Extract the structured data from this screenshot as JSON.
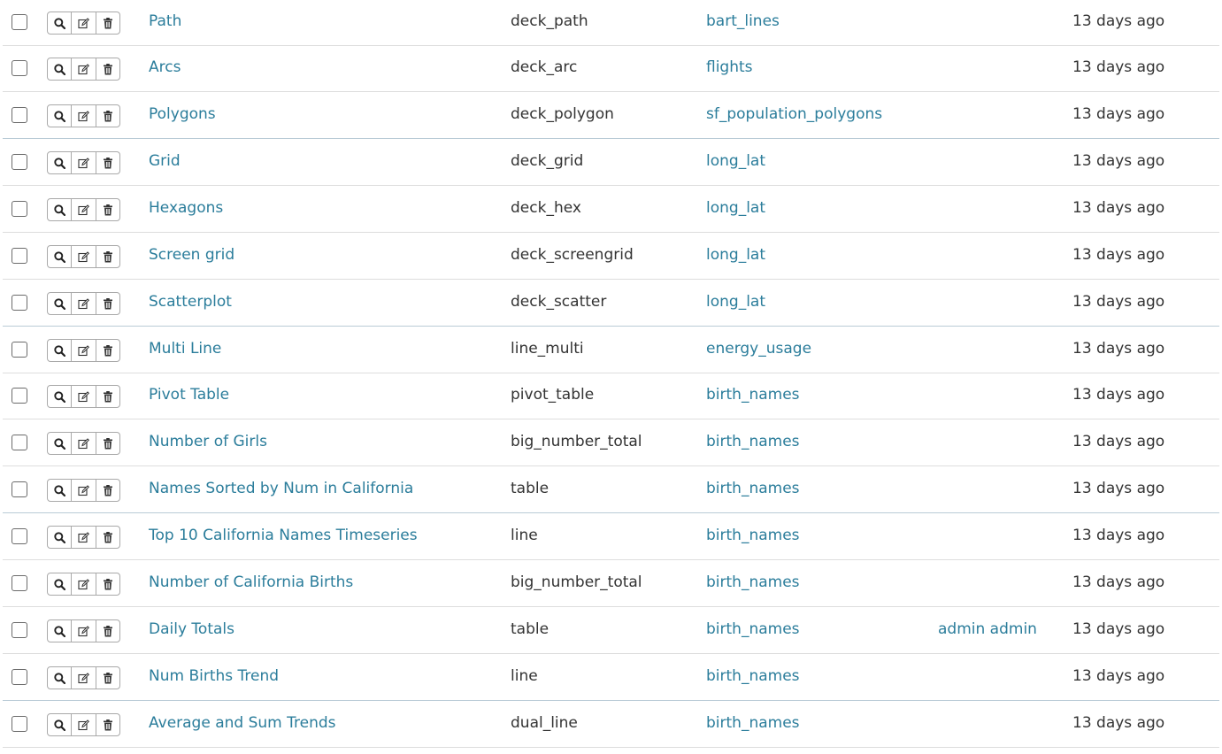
{
  "colors": {
    "link": "#2b7d9b",
    "text": "#333333",
    "border": "#dddddd"
  },
  "rows": [
    {
      "name": "Path",
      "viz_type": "deck_path",
      "datasource": "bart_lines",
      "creator": "",
      "modified": "13 days ago"
    },
    {
      "name": "Arcs",
      "viz_type": "deck_arc",
      "datasource": "flights",
      "creator": "",
      "modified": "13 days ago"
    },
    {
      "name": "Polygons",
      "viz_type": "deck_polygon",
      "datasource": "sf_population_polygons",
      "creator": "",
      "modified": "13 days ago"
    },
    {
      "name": "Grid",
      "viz_type": "deck_grid",
      "datasource": "long_lat",
      "creator": "",
      "modified": "13 days ago"
    },
    {
      "name": "Hexagons",
      "viz_type": "deck_hex",
      "datasource": "long_lat",
      "creator": "",
      "modified": "13 days ago"
    },
    {
      "name": "Screen grid",
      "viz_type": "deck_screengrid",
      "datasource": "long_lat",
      "creator": "",
      "modified": "13 days ago"
    },
    {
      "name": "Scatterplot",
      "viz_type": "deck_scatter",
      "datasource": "long_lat",
      "creator": "",
      "modified": "13 days ago"
    },
    {
      "name": "Multi Line",
      "viz_type": "line_multi",
      "datasource": "energy_usage",
      "creator": "",
      "modified": "13 days ago"
    },
    {
      "name": "Pivot Table",
      "viz_type": "pivot_table",
      "datasource": "birth_names",
      "creator": "",
      "modified": "13 days ago"
    },
    {
      "name": "Number of Girls",
      "viz_type": "big_number_total",
      "datasource": "birth_names",
      "creator": "",
      "modified": "13 days ago"
    },
    {
      "name": "Names Sorted by Num in California",
      "viz_type": "table",
      "datasource": "birth_names",
      "creator": "",
      "modified": "13 days ago"
    },
    {
      "name": "Top 10 California Names Timeseries",
      "viz_type": "line",
      "datasource": "birth_names",
      "creator": "",
      "modified": "13 days ago"
    },
    {
      "name": "Number of California Births",
      "viz_type": "big_number_total",
      "datasource": "birth_names",
      "creator": "",
      "modified": "13 days ago"
    },
    {
      "name": "Daily Totals",
      "viz_type": "table",
      "datasource": "birth_names",
      "creator": "admin admin",
      "modified": "13 days ago"
    },
    {
      "name": "Num Births Trend",
      "viz_type": "line",
      "datasource": "birth_names",
      "creator": "",
      "modified": "13 days ago"
    },
    {
      "name": "Average and Sum Trends",
      "viz_type": "dual_line",
      "datasource": "birth_names",
      "creator": "",
      "modified": "13 days ago"
    }
  ],
  "icons": {
    "select": "checkbox-icon",
    "show": "search-icon",
    "edit": "edit-icon",
    "delete": "trash-icon"
  }
}
